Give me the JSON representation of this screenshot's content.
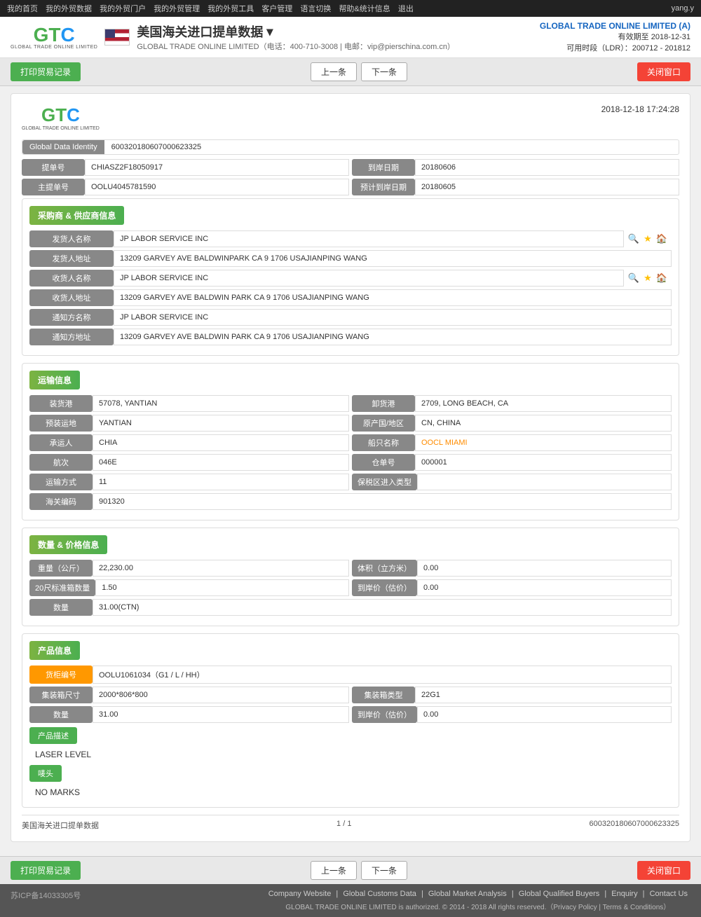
{
  "topnav": {
    "items": [
      "我的首页",
      "我的外贸数据",
      "我的外贸门户",
      "我的外贸管理",
      "我的外贸工具",
      "客户管理",
      "语言切换",
      "帮助&统计信息",
      "退出"
    ],
    "user": "yang.y"
  },
  "header": {
    "logo": {
      "g": "G",
      "t": "T",
      "c": "C",
      "sub": "GLOBAL TRADE ONLINE LIMITED"
    },
    "page_title": "美国海关进口提单数据",
    "page_title_dropdown": "▾",
    "page_subtitle": "GLOBAL TRADE ONLINE LIMITED（电话：400-710-3008 | 电邮：vip@pierschina.com.cn）",
    "company_name": "GLOBAL TRADE ONLINE LIMITED (A)",
    "validity": "有效期至 2018-12-31",
    "ldr": "可用时段（LDR）：200712 - 201812"
  },
  "toolbar": {
    "print_label": "打印贸易记录",
    "prev_label": "上一条",
    "next_label": "下一条",
    "close_label": "关闭窗口"
  },
  "document": {
    "timestamp": "2018-12-18 17:24:28",
    "global_id_label": "Global Data Identity",
    "global_id_value": "600320180607000623325",
    "bill_no_label": "提单号",
    "bill_no_value": "CHIASZ2F18050917",
    "arrival_date_label": "到岸日期",
    "arrival_date_value": "20180606",
    "master_bill_label": "主提单号",
    "master_bill_value": "OOLU4045781590",
    "est_arrival_label": "预计到岸日期",
    "est_arrival_value": "20180605",
    "section_buyer_supplier": "采购商 & 供应商信息",
    "shipper_name_label": "发货人名称",
    "shipper_name_value": "JP LABOR SERVICE INC",
    "shipper_addr_label": "发货人地址",
    "shipper_addr_value": "13209 GARVEY AVE BALDWINPARK CA 9 1706 USAJIANPING WANG",
    "consignee_name_label": "收货人名称",
    "consignee_name_value": "JP LABOR SERVICE INC",
    "consignee_addr_label": "收货人地址",
    "consignee_addr_value": "13209 GARVEY AVE BALDWIN PARK CA 9 1706 USAJIANPING WANG",
    "notify_name_label": "通知方名称",
    "notify_name_value": "JP LABOR SERVICE INC",
    "notify_addr_label": "通知方地址",
    "notify_addr_value": "13209 GARVEY AVE BALDWIN PARK CA 9 1706 USAJIANPING WANG",
    "section_transport": "运输信息",
    "load_port_label": "装货港",
    "load_port_value": "57078, YANTIAN",
    "dest_port_label": "卸货港",
    "dest_port_value": "2709, LONG BEACH, CA",
    "pre_load_label": "预装运地",
    "pre_load_value": "YANTIAN",
    "origin_country_label": "原产国/地区",
    "origin_country_value": "CN, CHINA",
    "carrier_label": "承运人",
    "carrier_value": "CHIA",
    "vessel_label": "船只名称",
    "vessel_value": "OOCL MIAMI",
    "voyage_label": "航次",
    "voyage_value": "046E",
    "warehouse_no_label": "仓单号",
    "warehouse_no_value": "000001",
    "transport_mode_label": "运输方式",
    "transport_mode_value": "11",
    "ftz_type_label": "保税区进入类型",
    "ftz_type_value": "",
    "customs_code_label": "海关编码",
    "customs_code_value": "901320",
    "section_quantity_price": "数量 & 价格信息",
    "weight_label": "重量（公斤）",
    "weight_value": "22,230.00",
    "volume_label": "体积（立方米）",
    "volume_value": "0.00",
    "teu20_label": "20尺标准箱数量",
    "teu20_value": "1.50",
    "arrival_price_label": "到岸价（估价）",
    "arrival_price_value": "0.00",
    "quantity_label": "数量",
    "quantity_value": "31.00(CTN)",
    "section_product": "产品信息",
    "container_no_label": "货柜编号",
    "container_no_value": "OOLU1061034（G1 / L / HH）",
    "container_size_label": "集装箱尺寸",
    "container_size_value": "2000*806*800",
    "container_type_label": "集装箱类型",
    "container_type_value": "22G1",
    "product_qty_label": "数量",
    "product_qty_value": "31.00",
    "product_arrival_price_label": "到岸价（估价）",
    "product_arrival_price_value": "0.00",
    "product_desc_label": "产品描述",
    "product_desc_value": "LASER LEVEL",
    "marks_label": "唛头",
    "marks_value": "NO MARKS",
    "footer_source": "美国海关进口提单数据",
    "footer_page": "1 / 1",
    "footer_id": "600320180607000623325"
  },
  "footer_links": [
    "Company Website",
    "Global Customs Data",
    "Global Market Analysis",
    "Global Qualified Buyers",
    "Enquiry",
    "Contact Us"
  ],
  "footer_copyright": "GLOBAL TRADE ONLINE LIMITED is authorized. © 2014 - 2018 All rights reserved.（Privacy Policy | Terms & Conditions）",
  "footer_icp": "苏ICP备14033305号",
  "icons": {
    "search": "🔍",
    "star": "★",
    "home": "🏠",
    "dropdown": "▾"
  }
}
